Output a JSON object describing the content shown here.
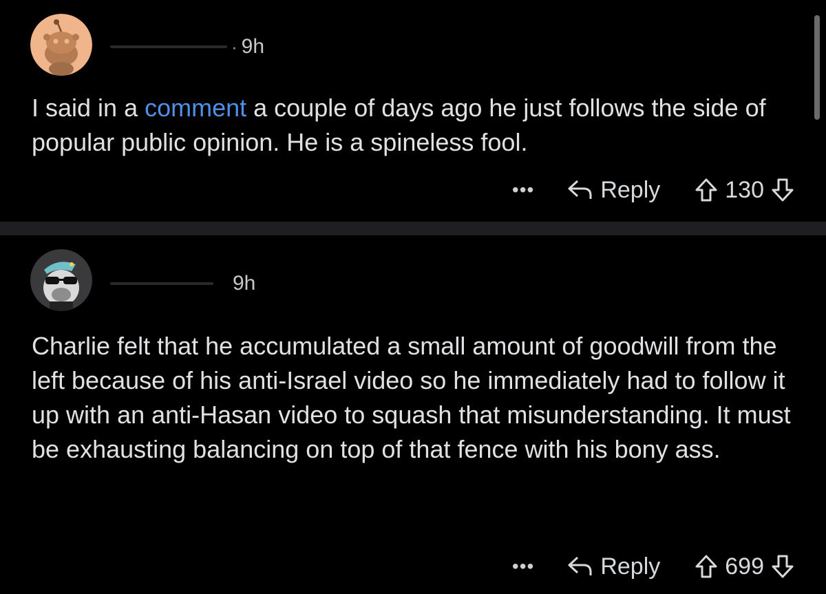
{
  "comments": [
    {
      "avatar": "reddit-snoo-orange-avatar",
      "username_redacted": true,
      "separator": "·",
      "time": "9h",
      "text_before_link": "I said in a ",
      "link_text": "comment",
      "text_after_link": " a couple of days ago he just follows the side of popular public opinion. He is a spineless fool.",
      "more_label": "•••",
      "reply_label": "Reply",
      "votes": "130"
    },
    {
      "avatar": "snoo-sunglasses-shark-hat-avatar",
      "username_redacted": true,
      "time": "9h",
      "text": "Charlie felt that he accumulated a small amount of goodwill from the left because of his anti-Israel video so he immediately had to follow it up with an anti-Hasan video to squash that misunderstanding. It must be exhausting balancing on top of that fence with his bony ass.",
      "more_label": "•••",
      "reply_label": "Reply",
      "votes": "699"
    }
  ],
  "colors": {
    "background": "#000000",
    "text": "#dfe1e3",
    "link": "#4f8fe8",
    "divider": "#1f1f21"
  }
}
